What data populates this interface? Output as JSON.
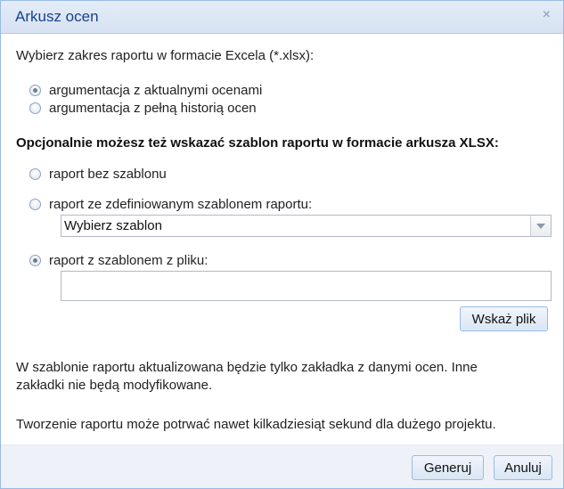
{
  "window": {
    "title": "Arkusz ocen",
    "close_symbol": "×"
  },
  "range": {
    "prompt": "Wybierz zakres raportu w formacie Excela (*.xlsx):",
    "options": [
      {
        "label": "argumentacja z aktualnymi ocenami",
        "checked": true
      },
      {
        "label": "argumentacja z pełną historią ocen",
        "checked": false
      }
    ]
  },
  "template": {
    "prompt": "Opcjonalnie możesz też wskazać szablon raportu w formacie arkusza XLSX:",
    "options": [
      {
        "label": "raport bez szablonu",
        "checked": false
      },
      {
        "label": "raport ze zdefiniowanym szablonem raportu:",
        "checked": false
      },
      {
        "label": "raport z szablonem z pliku:",
        "checked": true
      }
    ],
    "select_value": "Wybierz szablon",
    "file_value": "",
    "browse_label": "Wskaż plik"
  },
  "notes": {
    "line1": "W szablonie raportu aktualizowana będzie tylko zakładka z danymi ocen. Inne",
    "line2": "zakładki nie będą modyfikowane.",
    "timing": "Tworzenie raportu może potrwać nawet kilkadziesiąt sekund dla dużego projektu."
  },
  "footer": {
    "generate_label": "Generuj",
    "cancel_label": "Anuluj"
  }
}
